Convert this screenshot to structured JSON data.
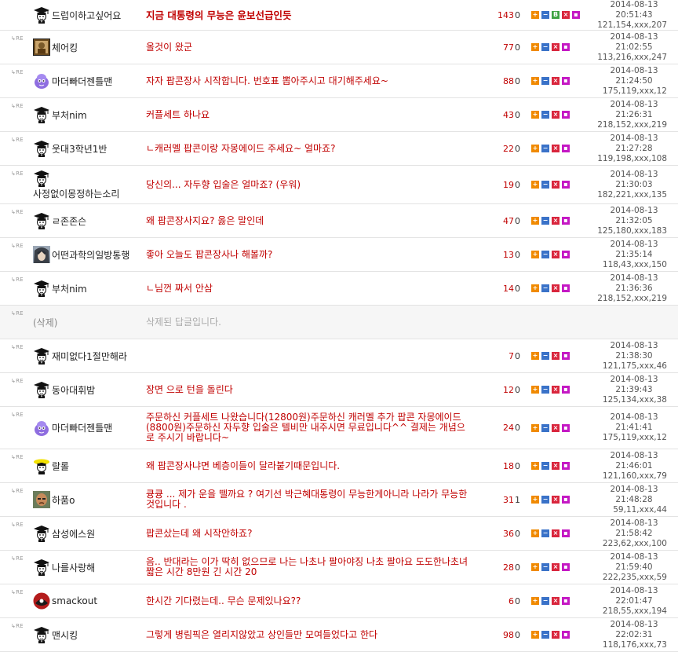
{
  "buttons": {
    "plus": "+",
    "minus": "−",
    "b": "B",
    "x": "×",
    "sq": "▪"
  },
  "re_label": "↳RE",
  "rows": [
    {
      "re": false,
      "avatar": "graduate-icon",
      "nick": "드럽이하고싶어요",
      "title": "지금 대통령의 무능은 윤보선급인듯",
      "views": "143",
      "recs": "0",
      "date": "2014-08-13",
      "time": "20:51:43",
      "ip": "121,154,xxx,207",
      "b": true
    },
    {
      "re": true,
      "avatar": "portrait-icon",
      "nick": "체어킹",
      "title": "올것이 왔군",
      "views": "77",
      "recs": "0",
      "date": "2014-08-13",
      "time": "21:02:55",
      "ip": "113,216,xxx,247"
    },
    {
      "re": true,
      "avatar": "blob-icon",
      "nick": "마더빠더젠틀맨",
      "title": "자자 팝콘장사 시작합니다. 번호표 뽑아주시고 대기해주세요~",
      "views": "88",
      "recs": "0",
      "date": "2014-08-13",
      "time": "21:24:50",
      "ip": "175,119,xxx,12"
    },
    {
      "re": true,
      "avatar": "graduate-icon",
      "nick": "부처nim",
      "title": "커플세트 하나요",
      "views": "43",
      "recs": "0",
      "date": "2014-08-13",
      "time": "21:26:31",
      "ip": "218,152,xxx,219"
    },
    {
      "re": true,
      "avatar": "graduate-icon",
      "nick": "웃대3학년1반",
      "title": "ㄴ캐러멜 팝콘이랑 자몽에이드 주세요~ 얼마죠?",
      "views": "22",
      "recs": "0",
      "date": "2014-08-13",
      "time": "21:27:28",
      "ip": "119,198,xxx,108"
    },
    {
      "re": true,
      "avatar": "graduate-icon",
      "nick": "사정없이몽정하는소리",
      "stack": true,
      "title": "당신의... 자두향 입술은 얼마죠? (우워)",
      "views": "19",
      "recs": "0",
      "date": "2014-08-13",
      "time": "21:30:03",
      "ip": "182,221,xxx,135"
    },
    {
      "re": true,
      "avatar": "graduate-icon",
      "nick": "ㄹ존존슨",
      "title": "왜 팝콘장사지요? 옳은 말인데",
      "views": "47",
      "recs": "0",
      "date": "2014-08-13",
      "time": "21:32:05",
      "ip": "125,180,xxx,183"
    },
    {
      "re": true,
      "avatar": "hair-icon",
      "nick": "어떤과학의일방통행",
      "title": "좋아 오늘도 팝콘장사나 해볼까?",
      "views": "13",
      "recs": "0",
      "date": "2014-08-13",
      "time": "21:35:14",
      "ip": "118,43,xxx,150"
    },
    {
      "re": true,
      "avatar": "graduate-icon",
      "nick": "부처nim",
      "title": "ㄴ님껀 짜서 안삼",
      "views": "14",
      "recs": "0",
      "date": "2014-08-13",
      "time": "21:36:36",
      "ip": "218,152,xxx,219"
    },
    {
      "re": true,
      "deleted": true,
      "nick": "(삭제)",
      "title": "삭제된 답글입니다."
    },
    {
      "re": true,
      "avatar": "graduate-icon",
      "nick": "재미없다1절만해라",
      "title": "",
      "views": "7",
      "recs": "0",
      "date": "2014-08-13",
      "time": "21:38:30",
      "ip": "121,175,xxx,46"
    },
    {
      "re": true,
      "avatar": "graduate-icon",
      "nick": "동아대휘밤",
      "title": "장면 으로 턴을 돌린다",
      "views": "12",
      "recs": "0",
      "date": "2014-08-13",
      "time": "21:39:43",
      "ip": "125,134,xxx,38"
    },
    {
      "re": true,
      "avatar": "blob-icon",
      "nick": "마더빠더젠틀맨",
      "title": "주문하신 커플세트 나왔습니다(12800원)주문하신 캐러멜 추가 팝콘 자몽에이드(8800원)주문하신 자두향 입술은 텔비만 내주시면 무료입니다^^ 결제는 개념으로 주시기 바랍니다~",
      "views": "24",
      "recs": "0",
      "date": "2014-08-13",
      "time": "21:41:41",
      "ip": "175,119,xxx,12"
    },
    {
      "re": true,
      "avatar": "yellow-icon",
      "nick": "랄롤",
      "title": "왜 팝콘장사냐면 베층이들이 달라붙기때문입니다.",
      "views": "18",
      "recs": "0",
      "date": "2014-08-13",
      "time": "21:46:01",
      "ip": "121,160,xxx,79"
    },
    {
      "re": true,
      "avatar": "bald-icon",
      "nick": "하품o",
      "title": "큥큥 ... 제가 운을 뗄까요 ? 여기선 박근혜대통령이 무능한게아니라 나라가 무능한것입니다 .",
      "views": "31",
      "recs": "1",
      "date": "2014-08-13",
      "time": "21:48:28",
      "ip": "59,11,xxx,44"
    },
    {
      "re": true,
      "avatar": "graduate-icon",
      "nick": "삼성에스원",
      "title": "팝콘샀는데 왜 시작안하죠?",
      "views": "36",
      "recs": "0",
      "date": "2014-08-13",
      "time": "21:58:42",
      "ip": "223,62,xxx,100"
    },
    {
      "re": true,
      "avatar": "graduate-icon",
      "nick": "나를사랑해",
      "title": "음.. 반대라는 이가 딱히 없으므로 나는 나초나 팔아야징 나초 팔아요 도도한나초녀 짧은 시간 8만원 긴 시간 20",
      "views": "28",
      "recs": "0",
      "date": "2014-08-13",
      "time": "21:59:40",
      "ip": "222,235,xxx,59"
    },
    {
      "re": true,
      "avatar": "red-icon",
      "nick": "smackout",
      "title": "한시간 기다렸는데.. 무슨 문제있나요??",
      "views": "6",
      "recs": "0",
      "date": "2014-08-13",
      "time": "22:01:47",
      "ip": "218,55,xxx,194"
    },
    {
      "re": true,
      "avatar": "graduate-icon",
      "nick": "맨시킹",
      "title": "그렇게 병림픽은 열리지않았고 상인들만 모여들었다고 한다",
      "views": "98",
      "recs": "0",
      "date": "2014-08-13",
      "time": "22:02:31",
      "ip": "118,176,xxx,73"
    }
  ]
}
